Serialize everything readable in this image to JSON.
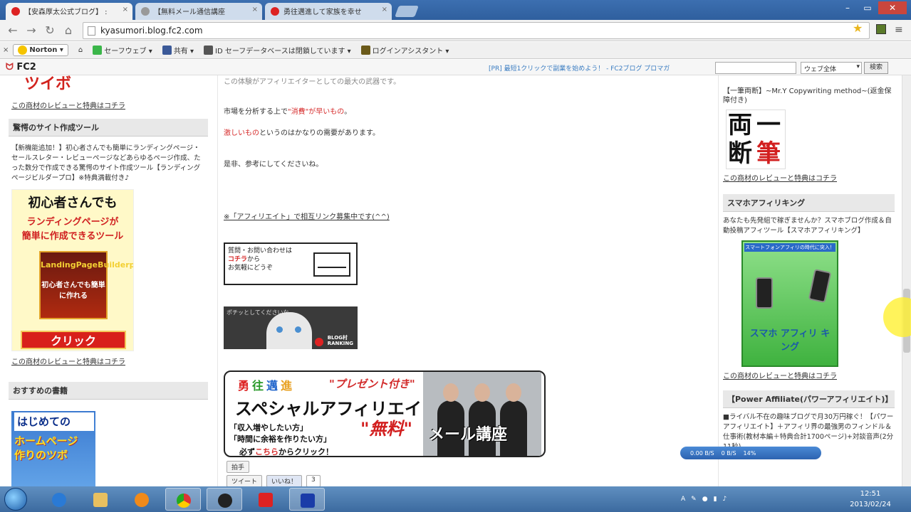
{
  "browser": {
    "tabs": [
      {
        "title": "【安森厚太公式ブログ】 : "
      },
      {
        "title": "【無料メール通信講座"
      },
      {
        "title": "勇往邁進して家族を幸せ"
      }
    ],
    "url": "kyasumori.blog.fc2.com"
  },
  "norton_bar": {
    "close": "×",
    "norton": "Norton ▾",
    "safeweb": "セーフウェブ ▾",
    "share": "共有 ▾",
    "idsafe": "ID セーフデータベースは閉鎖しています ▾",
    "login_assist": "ログインアシスタント ▾"
  },
  "fc2_bar": {
    "logo": "FC2",
    "ad": "[PR] 最短1クリックで副業を始めよう！ - FC2ブログ プロマガ",
    "scope": "ウェブ全体",
    "search_btn": "検索"
  },
  "left": {
    "top_title": "ツイボ",
    "review_link": "この商材のレビューと特典はコチラ",
    "section1": "驚愕のサイト作成ツール",
    "section1_desc": "【新機能追加！】初心者さんでも簡単にランディングページ・セールスレター・レビューページなどあらゆるページ作成、たった数分で作成できる驚愕のサイト作成ツール【ランディングページビルダープロ】※特典満載付き♪",
    "lp_banner": {
      "line1": "初心者さんでも",
      "line2": "ランディングページが",
      "line3": "簡単に作成できるツール",
      "box": "LandingPageBuilderpro",
      "box2": "初心者さんでも簡単に作れる",
      "click": "クリック"
    },
    "review_link2": "この商材のレビューと特典はコチラ",
    "section2": "おすすめの書籍",
    "hp_banner": {
      "line1": "はじめての",
      "line2": "ホームページ",
      "line3": "作りのツボ"
    }
  },
  "middle": {
    "line0": "この体験がアフィリエイターとしての最大の武器です。",
    "line1_pre": "市場を分析する上で",
    "line1_red": "\"消費\"が早いもの",
    "line1_post": "。",
    "line2_red": "激しいもの",
    "line2_post": "というのはかなりの需要があります。",
    "line3": "是非、参考にしてくださいね。",
    "line4": "※「アフィリエイト」で相互リンク募集中です(^^)",
    "mail_box": {
      "line1": "質問・お問い合わせは",
      "line2": "コチラ",
      "line2b": "から",
      "line3": "お気軽にどうぞ"
    },
    "cat_banner": {
      "caption": "ポチッとしてくださいな",
      "label1": "BLOG村",
      "label2": "RANKING"
    },
    "present": {
      "k1": "勇",
      "k2": "往",
      "k3": "邁",
      "k4": "進",
      "gift": "\"プレゼント付き\"",
      "big": "スペシャルアフィリエイト",
      "q1": "「収入増やしたい方」",
      "q2": "「時間に余裕を作りたい方」",
      "q3_pre": "必ず",
      "q3_red": "こちら",
      "q3_post": "からクリック！",
      "muryo": "\"無料\"",
      "course": "メール講座"
    },
    "social": {
      "clap": "拍手",
      "tweet": "ツイート",
      "like": "いいね！",
      "count": "3"
    }
  },
  "right": {
    "item1_title": "【一筆両断】~Mr.Y Copywriting method~(返金保障付き)",
    "kanji": [
      "両",
      "一",
      "断",
      "筆"
    ],
    "review_link": "この商材のレビューと特典はコチラ",
    "section1": "スマホアフィリキング",
    "section1_desc": "あなたも先発組で稼ぎませんか？スマホブログ作成＆自動投稿アフィツール【スマホアフィリキング】",
    "sumaho_title": "スマホ アフィリ キング",
    "sumaho_banner_top": "スマートフォンアフィリの時代に突入！",
    "review_link2": "この商材のレビューと特典はコチラ",
    "section2": "【Power Affiliate(パワーアフィリエイト)】",
    "section2_desc": "■ライバル不在の趣味ブログで月30万円稼ぐ！【パワーアフィリエイト】＋アフィリ界の最強男のフィンドル＆仕事術(教材本編＋特典合計1700ページ)+対談音声(2分11秒)"
  },
  "net_widget": {
    "down": "0.00 B/S",
    "up": "0 B/S",
    "pct": "14%"
  },
  "taskbar": {
    "time": "12:51",
    "date": "2013/02/24"
  },
  "colors": {
    "accent_red": "#d62b2b",
    "link_blue": "#3a7cc1",
    "taskbar": "#3c6a9f"
  }
}
